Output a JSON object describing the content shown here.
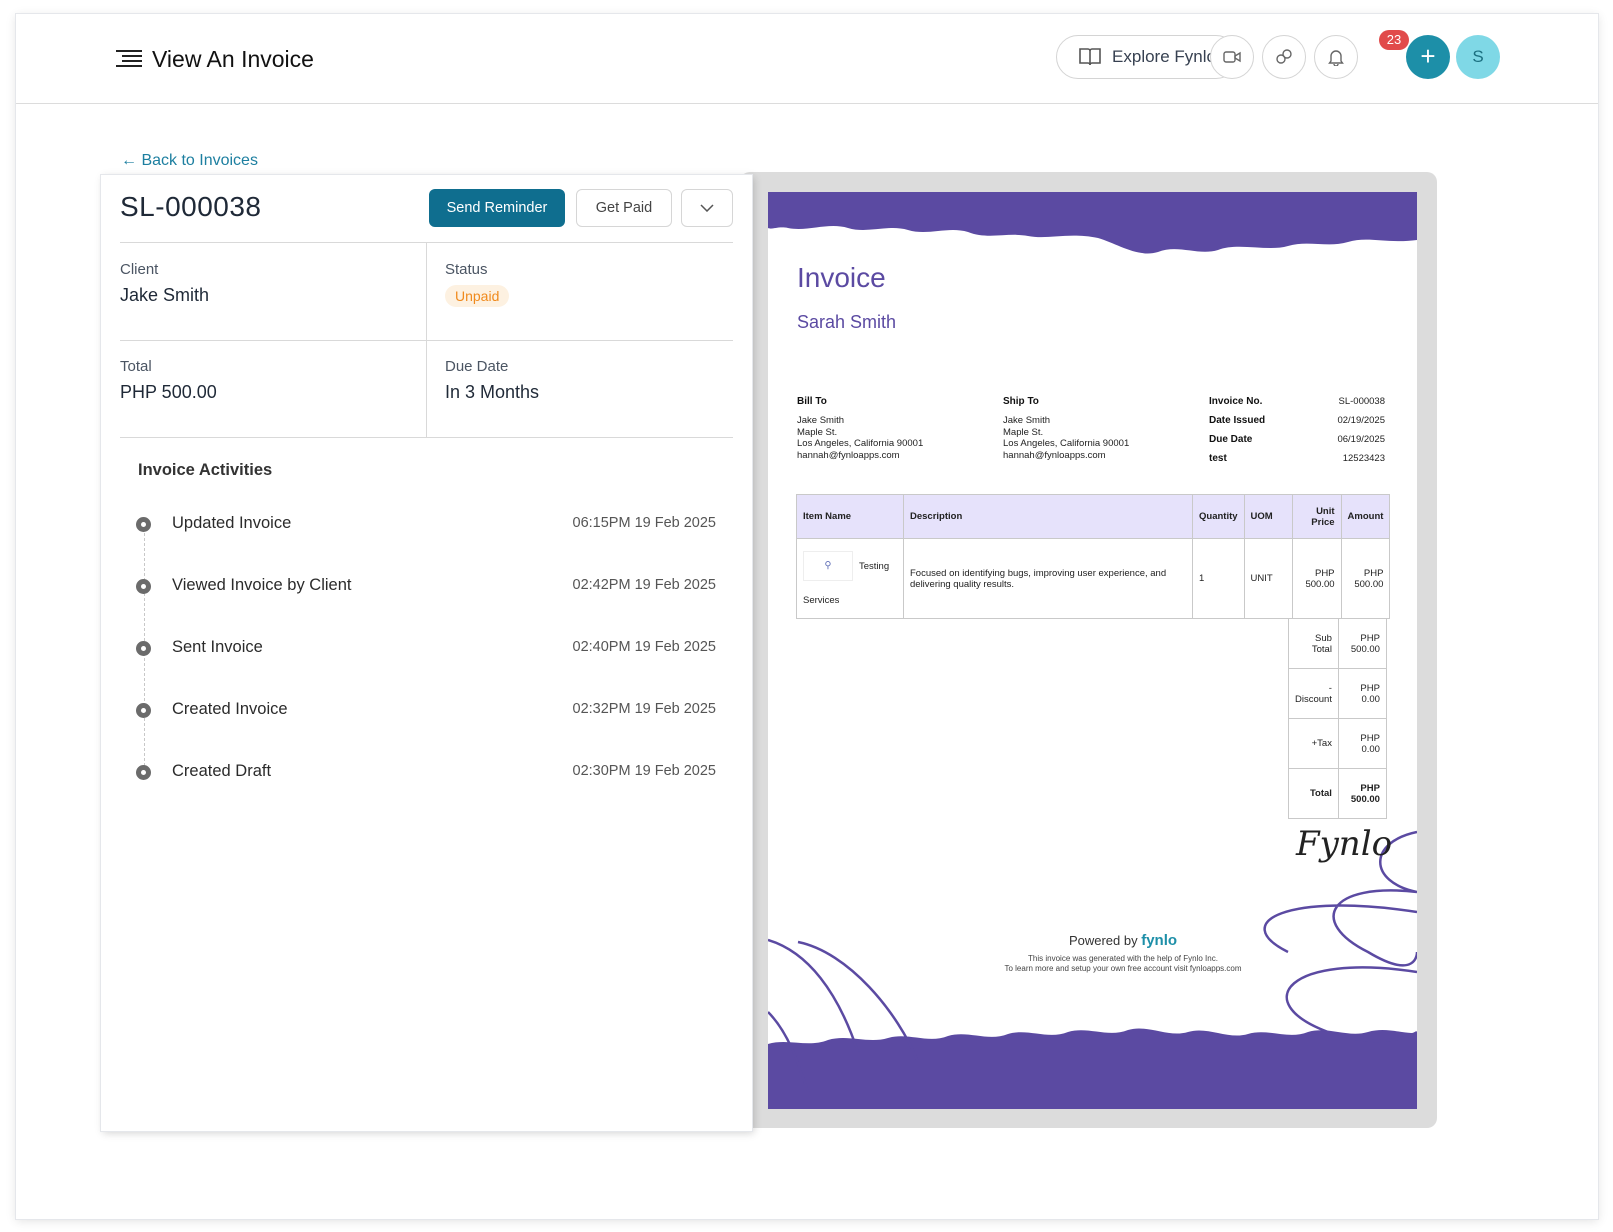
{
  "header": {
    "title": "View An Invoice",
    "explore_label": "Explore Fynlo",
    "notification_count": "23",
    "avatar_initial": "S",
    "plus_label": "+"
  },
  "back_link": "← Back to Invoices",
  "invoice": {
    "number": "SL-000038",
    "send_reminder": "Send Reminder",
    "get_paid": "Get Paid",
    "client_label": "Client",
    "client_value": "Jake Smith",
    "status_label": "Status",
    "status_value": "Unpaid",
    "total_label": "Total",
    "total_value": "PHP 500.00",
    "due_label": "Due Date",
    "due_value": "In 3 Months"
  },
  "activities": {
    "title": "Invoice Activities",
    "items": [
      {
        "label": "Updated Invoice",
        "time": "06:15PM 19 Feb 2025"
      },
      {
        "label": "Viewed Invoice by Client",
        "time": "02:42PM 19 Feb 2025"
      },
      {
        "label": "Sent Invoice",
        "time": "02:40PM 19 Feb 2025"
      },
      {
        "label": "Created Invoice",
        "time": "02:32PM 19 Feb 2025"
      },
      {
        "label": "Created Draft",
        "time": "02:30PM 19 Feb 2025"
      }
    ]
  },
  "preview": {
    "title": "Invoice",
    "sender": "Sarah Smith",
    "bill_to_label": "Bill To",
    "bill_to": [
      "Jake Smith",
      "Maple St.",
      "Los Angeles,  California 90001",
      "hannah@fynloapps.com"
    ],
    "ship_to_label": "Ship To",
    "ship_to": [
      "Jake Smith",
      "Maple St.",
      "Los Angeles, California 90001",
      "hannah@fynloapps.com"
    ],
    "meta": [
      {
        "label": "Invoice No.",
        "value": "SL-000038"
      },
      {
        "label": "Date Issued",
        "value": "02/19/2025"
      },
      {
        "label": "Due Date",
        "value": "06/19/2025"
      },
      {
        "label": "test",
        "value": "12523423"
      }
    ],
    "table_headers": {
      "item": "Item Name",
      "description": "Description",
      "quantity": "Quantity",
      "uom": "UOM",
      "unit_price": "Unit Price",
      "amount": "Amount"
    },
    "row": {
      "item_a": "Testing",
      "item_b": "Services",
      "description": "Focused on identifying bugs, improving user experience, and delivering quality results.",
      "quantity": "1",
      "uom": "UNIT",
      "unit_price": "PHP 500.00",
      "amount": "PHP 500.00"
    },
    "totals": [
      {
        "label": "Sub Total",
        "value": "PHP 500.00"
      },
      {
        "label": "- Discount",
        "value": "PHP 0.00"
      },
      {
        "label": "+Tax",
        "value": "PHP 0.00"
      },
      {
        "label": "Total",
        "value": "PHP 500.00"
      }
    ],
    "signature": "Fynlo",
    "powered_by": "Powered by",
    "powered_logo": "fynlo",
    "gen_note_1": "This invoice was generated with the help of Fynlo Inc.",
    "gen_note_2": "To learn more and setup your own free account visit fynloapps.com"
  },
  "colors": {
    "brand_teal": "#0f6e8f",
    "accent_purple": "#5b4aa2",
    "status_orange": "#f08a1d",
    "badge_red": "#e14b4b"
  },
  "icons": [
    "menu-icon",
    "book-icon",
    "video-icon",
    "chat-icon",
    "bell-icon",
    "plus-icon",
    "chevron-down-icon",
    "magnifier-icon"
  ]
}
